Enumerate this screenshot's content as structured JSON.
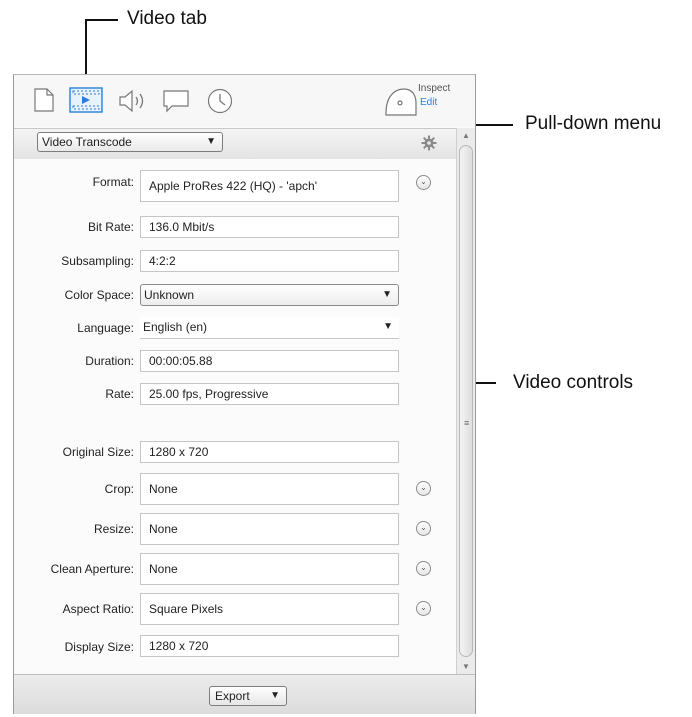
{
  "callouts": {
    "video_tab": "Video tab",
    "pulldown_menu": "Pull-down menu",
    "video_controls": "Video controls"
  },
  "toolbar": {
    "inspect_label": "Inspect",
    "edit_label": "Edit",
    "active_tab_color": "#2a7fd8"
  },
  "action_menu": {
    "value": "Video Transcode"
  },
  "fields": {
    "format": {
      "label": "Format:",
      "value": "Apple ProRes 422 (HQ) - 'apch'"
    },
    "bit_rate": {
      "label": "Bit Rate:",
      "value": "136.0 Mbit/s"
    },
    "subsampling": {
      "label": "Subsampling:",
      "value": "4:2:2"
    },
    "color_space": {
      "label": "Color Space:",
      "value": "Unknown"
    },
    "language": {
      "label": "Language:",
      "value": "English (en)"
    },
    "duration": {
      "label": "Duration:",
      "value": "00:00:05.88"
    },
    "rate": {
      "label": "Rate:",
      "value": "25.00 fps, Progressive"
    },
    "original_size": {
      "label": "Original Size:",
      "value": "1280 x 720"
    },
    "crop": {
      "label": "Crop:",
      "value": "None"
    },
    "resize": {
      "label": "Resize:",
      "value": "None"
    },
    "clean_aperture": {
      "label": "Clean Aperture:",
      "value": "None"
    },
    "aspect_ratio": {
      "label": "Aspect Ratio:",
      "value": "Square Pixels"
    },
    "display_size": {
      "label": "Display Size:",
      "value": "1280 x 720"
    }
  },
  "footer": {
    "export_label": "Export"
  }
}
